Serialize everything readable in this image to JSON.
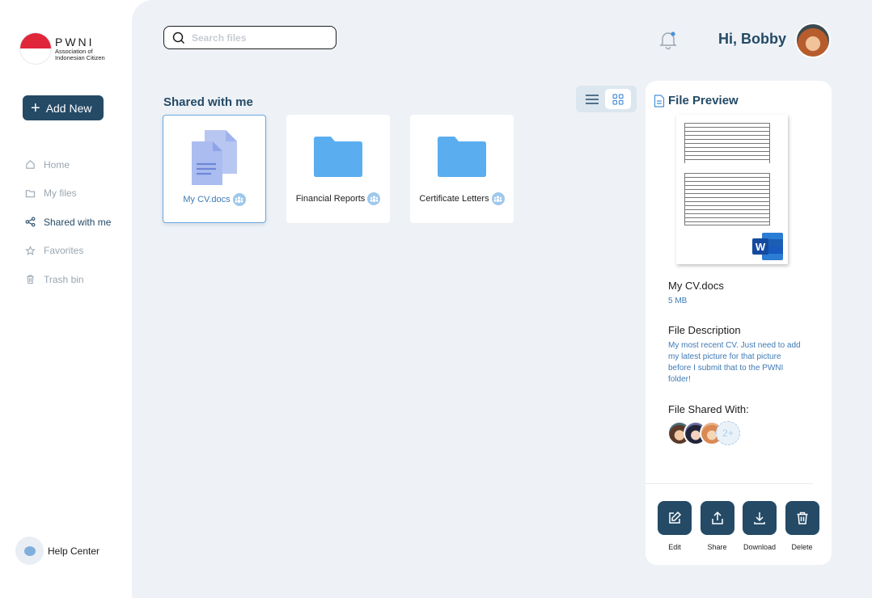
{
  "brand": {
    "name": "PWNI",
    "subtitle_line1": "Association of",
    "subtitle_line2": "Indonesian Citizen"
  },
  "sidebar": {
    "add_label": "Add New",
    "items": [
      {
        "label": "Home",
        "icon": "home-icon",
        "active": false
      },
      {
        "label": "My files",
        "icon": "folder-icon",
        "active": false
      },
      {
        "label": "Shared with me",
        "icon": "share-icon",
        "active": true
      },
      {
        "label": "Favorites",
        "icon": "star-icon",
        "active": false
      },
      {
        "label": "Trash bin",
        "icon": "trash-icon",
        "active": false
      }
    ],
    "help_label": "Help Center"
  },
  "header": {
    "search_placeholder": "Search files",
    "greeting": "Hi, Bobby"
  },
  "main": {
    "section_title": "Shared with me",
    "view_mode": "grid",
    "files": [
      {
        "name": "My CV.docs",
        "type": "document",
        "selected": true,
        "shared": true
      },
      {
        "name": "Financial Reports",
        "type": "folder",
        "selected": false,
        "shared": true
      },
      {
        "name": "Certificate Letters",
        "type": "folder",
        "selected": false,
        "shared": true
      }
    ]
  },
  "preview": {
    "title": "File Preview",
    "file_name": "My CV.docs",
    "file_size": "5 MB",
    "description_heading": "File Description",
    "description": "My most recent CV. Just need to add my latest picture for that picture before I submit that to the PWNI folder!",
    "shared_heading": "File Shared With:",
    "shared_more": "2+",
    "actions": [
      {
        "label": "Edit",
        "icon": "edit-icon"
      },
      {
        "label": "Share",
        "icon": "upload-share-icon"
      },
      {
        "label": "Download",
        "icon": "download-icon"
      },
      {
        "label": "Delete",
        "icon": "delete-icon"
      }
    ]
  },
  "colors": {
    "primary": "#244a66",
    "accent": "#6aa9e0",
    "folder": "#5aaef0",
    "background": "#eef2f6"
  }
}
